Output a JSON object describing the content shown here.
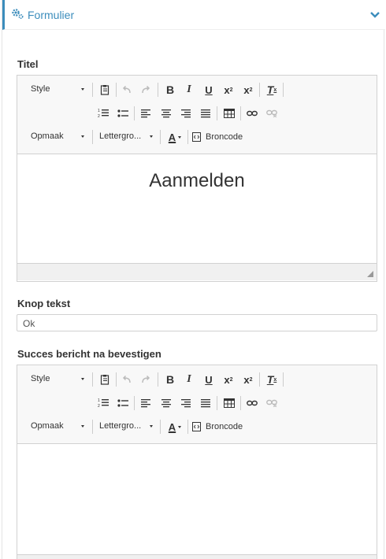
{
  "panel": {
    "title": "Formulier",
    "icon": "gears-icon",
    "collapse_icon": "chevron-down-icon",
    "accent": "#3c8dbc"
  },
  "toolbar": {
    "style_label": "Style",
    "format_label": "Opmaak",
    "fontsize_label": "Lettergro...",
    "source_label": "Broncode",
    "bold": "B",
    "italic": "I",
    "underline": "U",
    "subscript": "x",
    "superscript": "x",
    "removeformat": "T",
    "textcolor": "A"
  },
  "fields": {
    "title": {
      "label": "Titel",
      "content": "Aanmelden"
    },
    "button": {
      "label": "Knop tekst",
      "value": "Ok"
    },
    "success": {
      "label": "Succes bericht na bevestigen",
      "content": ""
    }
  }
}
